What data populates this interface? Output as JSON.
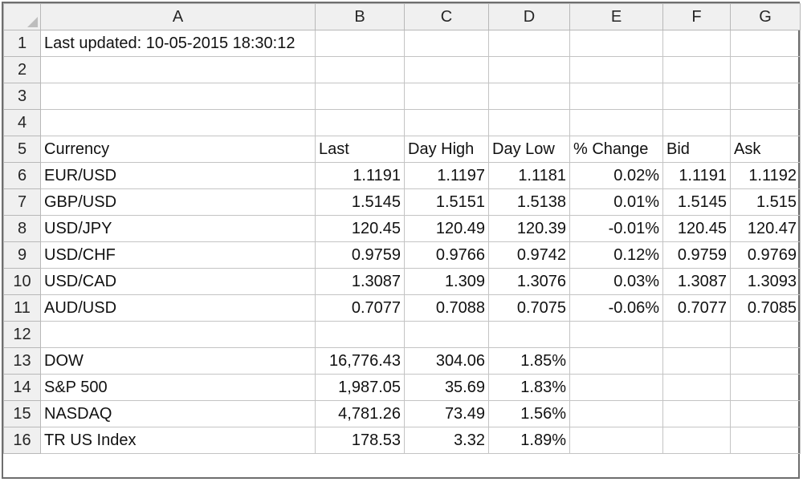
{
  "columns": [
    "A",
    "B",
    "C",
    "D",
    "E",
    "F",
    "G"
  ],
  "cells": {
    "A1": "Last updated: 10-05-2015 18:30:12",
    "A5": "Currency",
    "B5": "Last",
    "C5": "Day High",
    "D5": "Day Low",
    "E5": "% Change",
    "F5": "Bid",
    "G5": "Ask",
    "A6": "EUR/USD",
    "B6": "1.1191",
    "C6": "1.1197",
    "D6": "1.1181",
    "E6": "0.02%",
    "F6": "1.1191",
    "G6": "1.1192",
    "A7": "GBP/USD",
    "B7": "1.5145",
    "C7": "1.5151",
    "D7": "1.5138",
    "E7": "0.01%",
    "F7": "1.5145",
    "G7": "1.515",
    "A8": "USD/JPY",
    "B8": "120.45",
    "C8": "120.49",
    "D8": "120.39",
    "E8": "-0.01%",
    "F8": "120.45",
    "G8": "120.47",
    "A9": "USD/CHF",
    "B9": "0.9759",
    "C9": "0.9766",
    "D9": "0.9742",
    "E9": "0.12%",
    "F9": "0.9759",
    "G9": "0.9769",
    "A10": "USD/CAD",
    "B10": "1.3087",
    "C10": "1.309",
    "D10": "1.3076",
    "E10": "0.03%",
    "F10": "1.3087",
    "G10": "1.3093",
    "A11": "AUD/USD",
    "B11": "0.7077",
    "C11": "0.7088",
    "D11": "0.7075",
    "E11": "-0.06%",
    "F11": "0.7077",
    "G11": "0.7085",
    "A13": "DOW",
    "B13": "16,776.43",
    "C13": "304.06",
    "D13": "1.85%",
    "A14": "S&P 500",
    "B14": "1,987.05",
    "C14": "35.69",
    "D14": "1.83%",
    "A15": "NASDAQ",
    "B15": "4,781.26",
    "C15": "73.49",
    "D15": "1.56%",
    "A16": "TR US Index",
    "B16": "178.53",
    "C16": "3.32",
    "D16": "1.89%"
  },
  "rows": [
    "1",
    "2",
    "3",
    "4",
    "5",
    "6",
    "7",
    "8",
    "9",
    "10",
    "11",
    "12",
    "13",
    "14",
    "15",
    "16"
  ]
}
